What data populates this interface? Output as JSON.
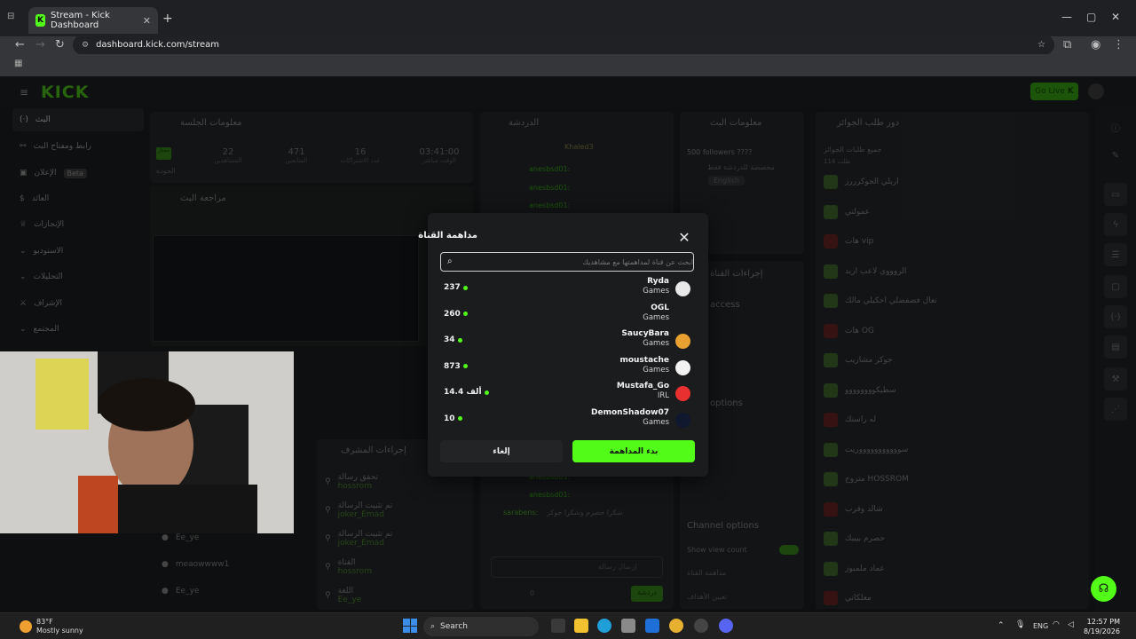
{
  "browser": {
    "tab_title": "Stream - Kick Dashboard",
    "url": "dashboard.kick.com/stream"
  },
  "dashboard": {
    "logo": "KICK",
    "go_live": "Go Live",
    "sidebar": [
      {
        "label": "البث",
        "icon": "stream-icon"
      },
      {
        "label": "رابط ومفتاح البث",
        "icon": "link-icon"
      },
      {
        "label": "الإعلان",
        "badge": "Beta",
        "icon": "ad-icon"
      },
      {
        "label": "العائد",
        "icon": "money-icon"
      },
      {
        "label": "الإنجازات",
        "icon": "trophy-icon"
      },
      {
        "label": "الاستوديو",
        "icon": "studio-icon"
      },
      {
        "label": "التحليلات",
        "icon": "chart-icon"
      },
      {
        "label": "الإشراف",
        "icon": "shield-icon"
      },
      {
        "label": "المجتمع",
        "icon": "community-icon"
      }
    ],
    "session": {
      "title": "معلومات الجلسة",
      "stats": [
        {
          "value": "03:41:00",
          "label": "الوقت مباشر"
        },
        {
          "value": "16",
          "label": "عدد الاشتراكات"
        },
        {
          "value": "471",
          "label": "المتابعين"
        },
        {
          "value": "22",
          "label": "المشاهدين"
        }
      ],
      "status": "ممتاز",
      "status_label": "الجودة"
    },
    "review_title": "مراجعة البث",
    "chat": {
      "title": "الدردشة",
      "pinned_user": "Khaled3",
      "user": "anesbsd01:",
      "bottom_message_user": "sarabens:",
      "bottom_message": "شكرا حصرم وشكرا جوكر",
      "send": "دردشة",
      "input_placeholder": "إرسال رسالة",
      "count": "0"
    },
    "stream_info": {
      "title": "معلومات البث",
      "stream_title": "500 followers ????",
      "category": "مخصصة للدردشة فقط",
      "language": "English"
    },
    "channel_actions_title": "إجراءات القناة",
    "channel_actions": {
      "access": "access",
      "options": "options",
      "channel_options": "Channel options",
      "show_view_count": "Show view count",
      "host": "مداهمة القناة",
      "goals": "تعيين الأهداف"
    },
    "mod_actions": {
      "title": "إجراءات المشرف",
      "items": [
        {
          "user": "hossrom",
          "desc": "تحقق رسالة"
        },
        {
          "user": "joker_Emad",
          "desc": "تم تثبيت الرسالة"
        },
        {
          "user": "joker_Emad",
          "desc": "تم تثبيت الرسالة"
        },
        {
          "user": "hossrom",
          "desc": "القناة"
        },
        {
          "user": "Ee_ye",
          "desc": "اللغة"
        }
      ]
    },
    "users_list": [
      {
        "name": "Ee_ye"
      },
      {
        "name": "meaowwww1"
      },
      {
        "name": "Ee_ye"
      }
    ],
    "rewards": {
      "title": "دور طلب الجوائز",
      "header": "جميع طلبات الجوائز",
      "header_sub": "114 طلب",
      "items": [
        "اربلي الجوكرررز",
        "عمولتي",
        "هات vip",
        "الروووي لاعب اريد",
        "تعال فضفضلي احكيلي مالك",
        "هات OG",
        "جوكر مشاريب",
        "سطيكوووووووو",
        "له راستك",
        "سوووووووووووريت",
        "متزوج HOSSROM",
        "شالد وقرب",
        "حصرم بيبيك",
        "عماد ملمبوز",
        "معلكاتي"
      ]
    }
  },
  "modal": {
    "title": "مداهمة القناة",
    "search_placeholder": "ابحث عن قناة لمداهمتها مع مشاهديك",
    "channels": [
      {
        "name": "Ryda",
        "category": "Games",
        "viewers": "237",
        "avatar_color": "#e8e8e8"
      },
      {
        "name": "OGL",
        "category": "Games",
        "viewers": "260",
        "avatar_color": "#1b1c1e"
      },
      {
        "name": "SaucyBara",
        "category": "Games",
        "viewers": "34",
        "avatar_color": "#e8a030"
      },
      {
        "name": "moustache",
        "category": "Games",
        "viewers": "873",
        "avatar_color": "#f2f2f2"
      },
      {
        "name": "Mustafa_Go",
        "category": "IRL",
        "viewers": "14.4 ألف",
        "avatar_color": "#e83030"
      },
      {
        "name": "DemonShadow07",
        "category": "Games",
        "viewers": "10",
        "avatar_color": "#101830"
      }
    ],
    "cancel": "إلغاء",
    "start": "بدء المداهمة"
  },
  "taskbar": {
    "temp": "83°F",
    "weather": "Mostly sunny",
    "search": "Search",
    "lang": "ENG",
    "time": "12:57 PM",
    "date": "8/19/2026"
  }
}
